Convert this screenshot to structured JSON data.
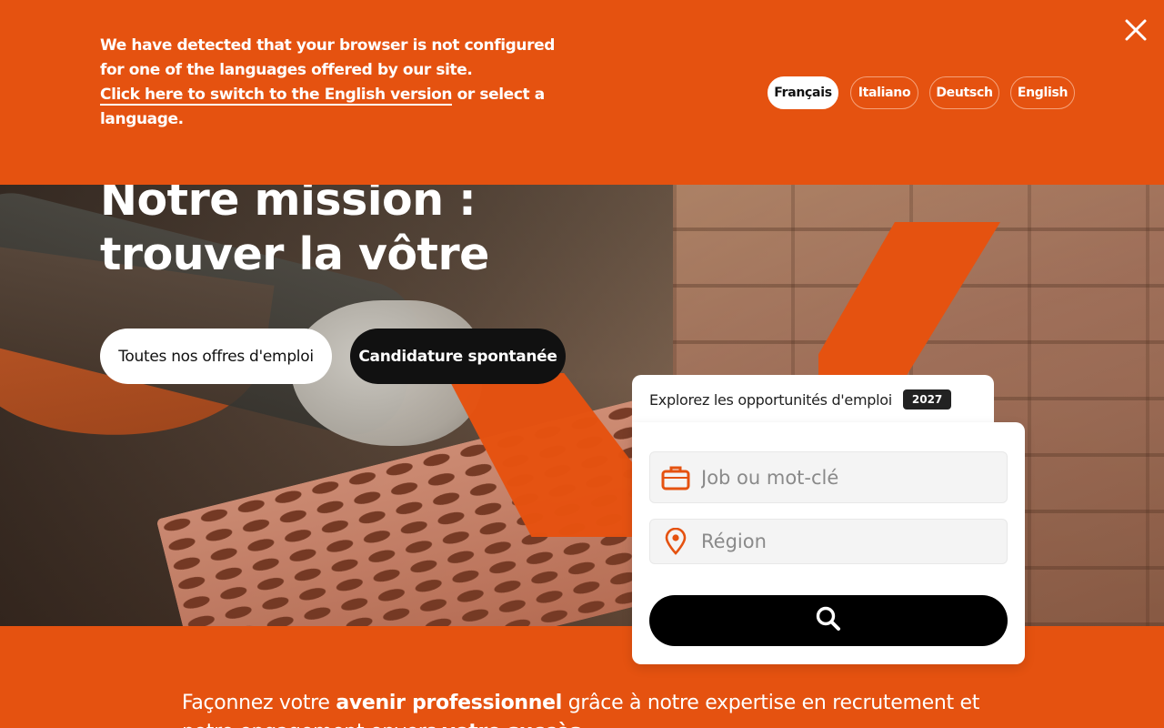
{
  "banner": {
    "text_line1": "We have detected that your browser is not configured for one of the languages offered by our site.",
    "switch_link": "Click here to switch to the English version",
    "text_line2": " or select a language.",
    "languages": [
      "Français",
      "Italiano",
      "Deutsch",
      "English"
    ],
    "active_language": "Français",
    "close_icon": "close-icon"
  },
  "hero": {
    "title_line1": "Notre mission :",
    "title_line2": "trouver la vôtre",
    "btn_all_jobs": "Toutes nos offres d'emploi",
    "btn_spontaneous": "Candidature spontanée"
  },
  "search": {
    "tab_title": "Explorez les opportunités d'emploi",
    "year_badge": "2027",
    "job_placeholder": "Job ou mot-clé",
    "region_placeholder": "Région",
    "job_icon": "briefcase-icon",
    "region_icon": "location-pin-icon",
    "submit_icon": "search-icon"
  },
  "tagline": {
    "part1": "Façonnez votre ",
    "bold1": "avenir professionnel",
    "part2": " grâce à notre expertise en recrutement et notre engagement envers ",
    "bold2": "votre succès",
    "part3": "."
  },
  "colors": {
    "brand_orange": "#e55210",
    "dark": "#111111",
    "white": "#ffffff"
  }
}
